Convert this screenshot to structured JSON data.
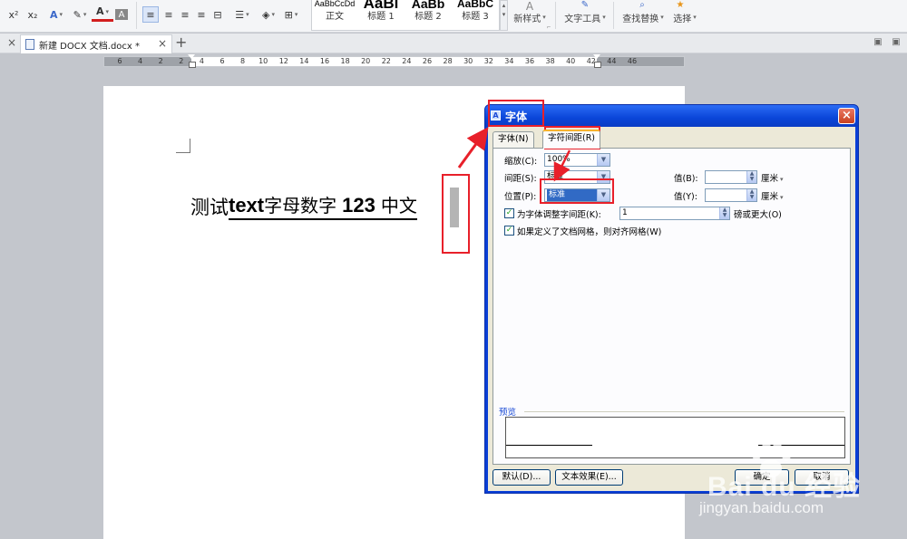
{
  "ribbon": {
    "styles": [
      {
        "preview": "AaBbCcDd",
        "label": "正文"
      },
      {
        "preview": "AaBl",
        "label": "标题 1"
      },
      {
        "preview": "AaBb",
        "label": "标题 2"
      },
      {
        "preview": "AaBbC",
        "label": "标题 3"
      }
    ],
    "new_style": "新样式",
    "text_tools": "文字工具",
    "find_replace": "查找替换",
    "select": "选择"
  },
  "tabbar": {
    "doc_title": "新建 DOCX 文档.docx *",
    "close_glyph": "×",
    "add_glyph": "+"
  },
  "ruler": {
    "ticks": [
      "6",
      "4",
      "2",
      "2",
      "4",
      "6",
      "8",
      "10",
      "12",
      "14",
      "16",
      "18",
      "20",
      "22",
      "24",
      "26",
      "28",
      "30",
      "32",
      "34",
      "36",
      "38",
      "40",
      "42",
      "44",
      "46"
    ]
  },
  "document": {
    "text_cn1": "测试",
    "text_en": "text",
    "text_cn2": "字母数字",
    "text_num": "123",
    "text_cn3": "中文"
  },
  "dialog": {
    "title": "字体",
    "tabs": [
      {
        "label": "字体(N)"
      },
      {
        "label": "字符间距(R)"
      }
    ],
    "scale_label": "缩放(C):",
    "scale_value": "100%",
    "spacing_label": "间距(S):",
    "spacing_value": "标准",
    "spacing_by_label": "值(B):",
    "spacing_by_value": "",
    "position_label": "位置(P):",
    "position_value": "标准",
    "position_by_label": "值(Y):",
    "position_by_value": "",
    "unit": "厘米",
    "kerning_label": "为字体调整字间距(K):",
    "kerning_value": "1",
    "kerning_suffix": "磅或更大(O)",
    "grid_label": "如果定义了文档网格，则对齐网格(W)",
    "preview_label": "预览",
    "btn_default": "默认(D)...",
    "btn_effects": "文本效果(E)...",
    "btn_ok": "确定",
    "btn_cancel": "取消"
  },
  "watermark": {
    "brand": "Bai du 经验",
    "url": "jingyan.baidu.com"
  },
  "colors": {
    "annotation_red": "#e8202a",
    "dialog_title_blue": "#0a45d8",
    "selection_blue": "#316ac5"
  }
}
